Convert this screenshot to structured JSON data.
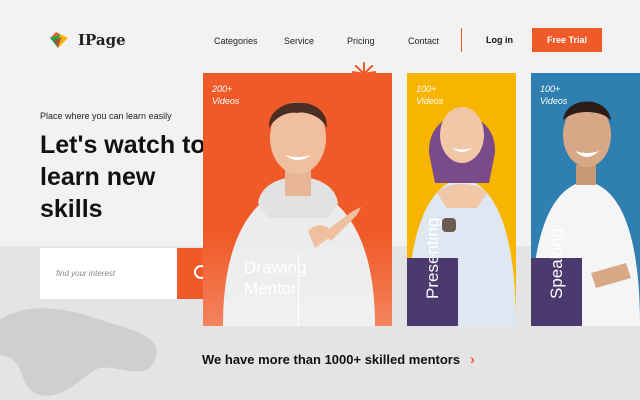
{
  "brand": {
    "name": "IPage"
  },
  "nav": {
    "items": [
      "Categories",
      "Service",
      "Pricing",
      "Contact"
    ],
    "login": "Log in",
    "cta": "Free Trial"
  },
  "hero": {
    "tagline": "Place where you can learn easily",
    "headline": "Let's watch to learn new skills",
    "search_placeholder": "find your interest"
  },
  "cards": [
    {
      "videos": "200+\nVideos",
      "label": "Drawing\nMentor",
      "bg": "#f05a28"
    },
    {
      "videos": "100+\nVideos",
      "label": "Presenting",
      "bg": "#f7b500"
    },
    {
      "videos": "100+\nVideos",
      "label": "Speaking",
      "bg": "#2f7fb0"
    }
  ],
  "footer": {
    "text": "We have more than 1000+ skilled mentors"
  },
  "colors": {
    "accent": "#f05a28",
    "purple": "#4b3a6e"
  }
}
